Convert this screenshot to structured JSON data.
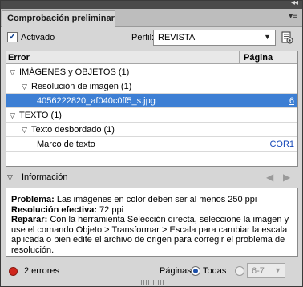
{
  "panel": {
    "title": "Comprobación preliminar",
    "menu_glyph": "▾≡"
  },
  "toolbar": {
    "activado_label": "Activado",
    "activado_checked": true,
    "perfil_label": "Perfil:",
    "perfil_value": "REVISTA"
  },
  "list": {
    "headers": {
      "error": "Error",
      "pagina": "Página"
    },
    "rows": [
      {
        "label": "IMÁGENES y OBJETOS (1)",
        "page": "",
        "level": 0,
        "expanded": true,
        "selected": false
      },
      {
        "label": "Resolución de imagen (1)",
        "page": "",
        "level": 1,
        "expanded": true,
        "selected": false
      },
      {
        "label": "4056222820_af040c0ff5_s.jpg",
        "page": "6",
        "level": 2,
        "expanded": false,
        "selected": true
      },
      {
        "label": "TEXTO (1)",
        "page": "",
        "level": 0,
        "expanded": true,
        "selected": false
      },
      {
        "label": "Texto desbordado (1)",
        "page": "",
        "level": 1,
        "expanded": true,
        "selected": false
      },
      {
        "label": "Marco de texto",
        "page": "COR1",
        "level": 2,
        "expanded": false,
        "selected": false
      }
    ]
  },
  "info": {
    "label": "Información",
    "problem_label": "Problema:",
    "problem_text": "Las imágenes en color deben ser al menos 250 ppi",
    "resolution_label": "Resolución efectiva:",
    "resolution_text": "72 ppi",
    "fix_label": "Reparar:",
    "fix_text": "Con la herramienta Selección directa, seleccione la imagen y use el comando Objeto > Transformar > Escala para cambiar la escala aplicada o bien edite el archivo de origen para corregir el problema de resolución."
  },
  "status": {
    "errors": "2 errores",
    "pages_label": "Páginas:",
    "todas_label": "Todas",
    "range_value": "6-7",
    "error_color": "#d0261c"
  }
}
